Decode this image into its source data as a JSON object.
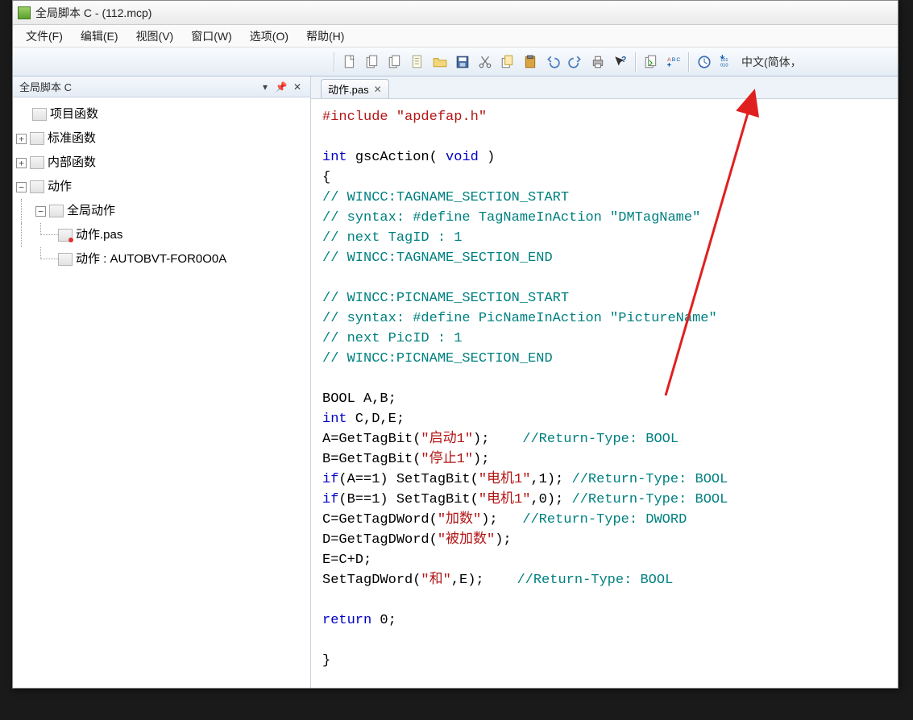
{
  "window": {
    "title_prefix": "全局脚本 C - ",
    "filename": "(112.mcp)"
  },
  "menu": {
    "file": "文件(F)",
    "edit": "编辑(E)",
    "view": "视图(V)",
    "window": "窗口(W)",
    "options": "选项(O)",
    "help": "帮助(H)"
  },
  "toolbar": {
    "language": "中文(简体，",
    "icons": {
      "new": "new-icon",
      "copy_page": "copy-page-icon",
      "layers": "layers-icon",
      "doc": "doc-icon",
      "open": "open-icon",
      "save": "save-icon",
      "cut": "cut-icon",
      "copy": "copy-icon",
      "paste": "paste-icon",
      "undo": "undo-icon",
      "redo": "redo-icon",
      "print": "print-icon",
      "help_ptr": "help-pointer-icon",
      "compile": "compile-icon",
      "abc_arrow": "abc-icon",
      "clock": "clock-icon",
      "binary": "binary-icon"
    }
  },
  "sidebar": {
    "title": "全局脚本 C",
    "items": {
      "project_fn": "项目函数",
      "standard_fn": "标准函数",
      "internal_fn": "内部函数",
      "actions": "动作",
      "global_actions": "全局动作",
      "action_pas": "动作.pas",
      "action_auto": "动作 : AUTOBVT-FOR0O0A"
    }
  },
  "tab": {
    "label": "动作.pas"
  },
  "code": {
    "l01a": "#include",
    "l01b": "\"apdefap.h\"",
    "l02": "",
    "l03a": "int",
    "l03b": "gscAction(",
    "l03c": "void",
    "l03d": ")",
    "l04": "{",
    "l05": "// WINCC:TAGNAME_SECTION_START",
    "l06": "// syntax: #define TagNameInAction \"DMTagName\"",
    "l07": "// next TagID : 1",
    "l08": "// WINCC:TAGNAME_SECTION_END",
    "l09": "",
    "l10": "// WINCC:PICNAME_SECTION_START",
    "l11": "// syntax: #define PicNameInAction \"PictureName\"",
    "l12": "// next PicID : 1",
    "l13": "// WINCC:PICNAME_SECTION_END",
    "l14": "",
    "l15a": "BOOL A,B;",
    "l16a": "int",
    "l16b": " C,D,E;",
    "l17a": "A=GetTagBit(",
    "l17b": "\"启动1\"",
    "l17c": ");    ",
    "l17d": "//Return-Type: BOOL",
    "l18a": "B=GetTagBit(",
    "l18b": "\"停止1\"",
    "l18c": ");",
    "l19a": "if",
    "l19b": "(A==1) SetTagBit(",
    "l19c": "\"电机1\"",
    "l19d": ",1); ",
    "l19e": "//Return-Type: BOOL",
    "l20a": "if",
    "l20b": "(B==1) SetTagBit(",
    "l20c": "\"电机1\"",
    "l20d": ",0); ",
    "l20e": "//Return-Type: BOOL",
    "l21a": "C=GetTagDWord(",
    "l21b": "\"加数\"",
    "l21c": ");   ",
    "l21d": "//Return-Type: DWORD",
    "l22a": "D=GetTagDWord(",
    "l22b": "\"被加数\"",
    "l22c": ");",
    "l23": "E=C+D;",
    "l24a": "SetTagDWord(",
    "l24b": "\"和\"",
    "l24c": ",E);    ",
    "l24d": "//Return-Type: BOOL",
    "l25": "",
    "l26a": "return",
    "l26b": " 0;",
    "l27": "",
    "l28": "}"
  }
}
